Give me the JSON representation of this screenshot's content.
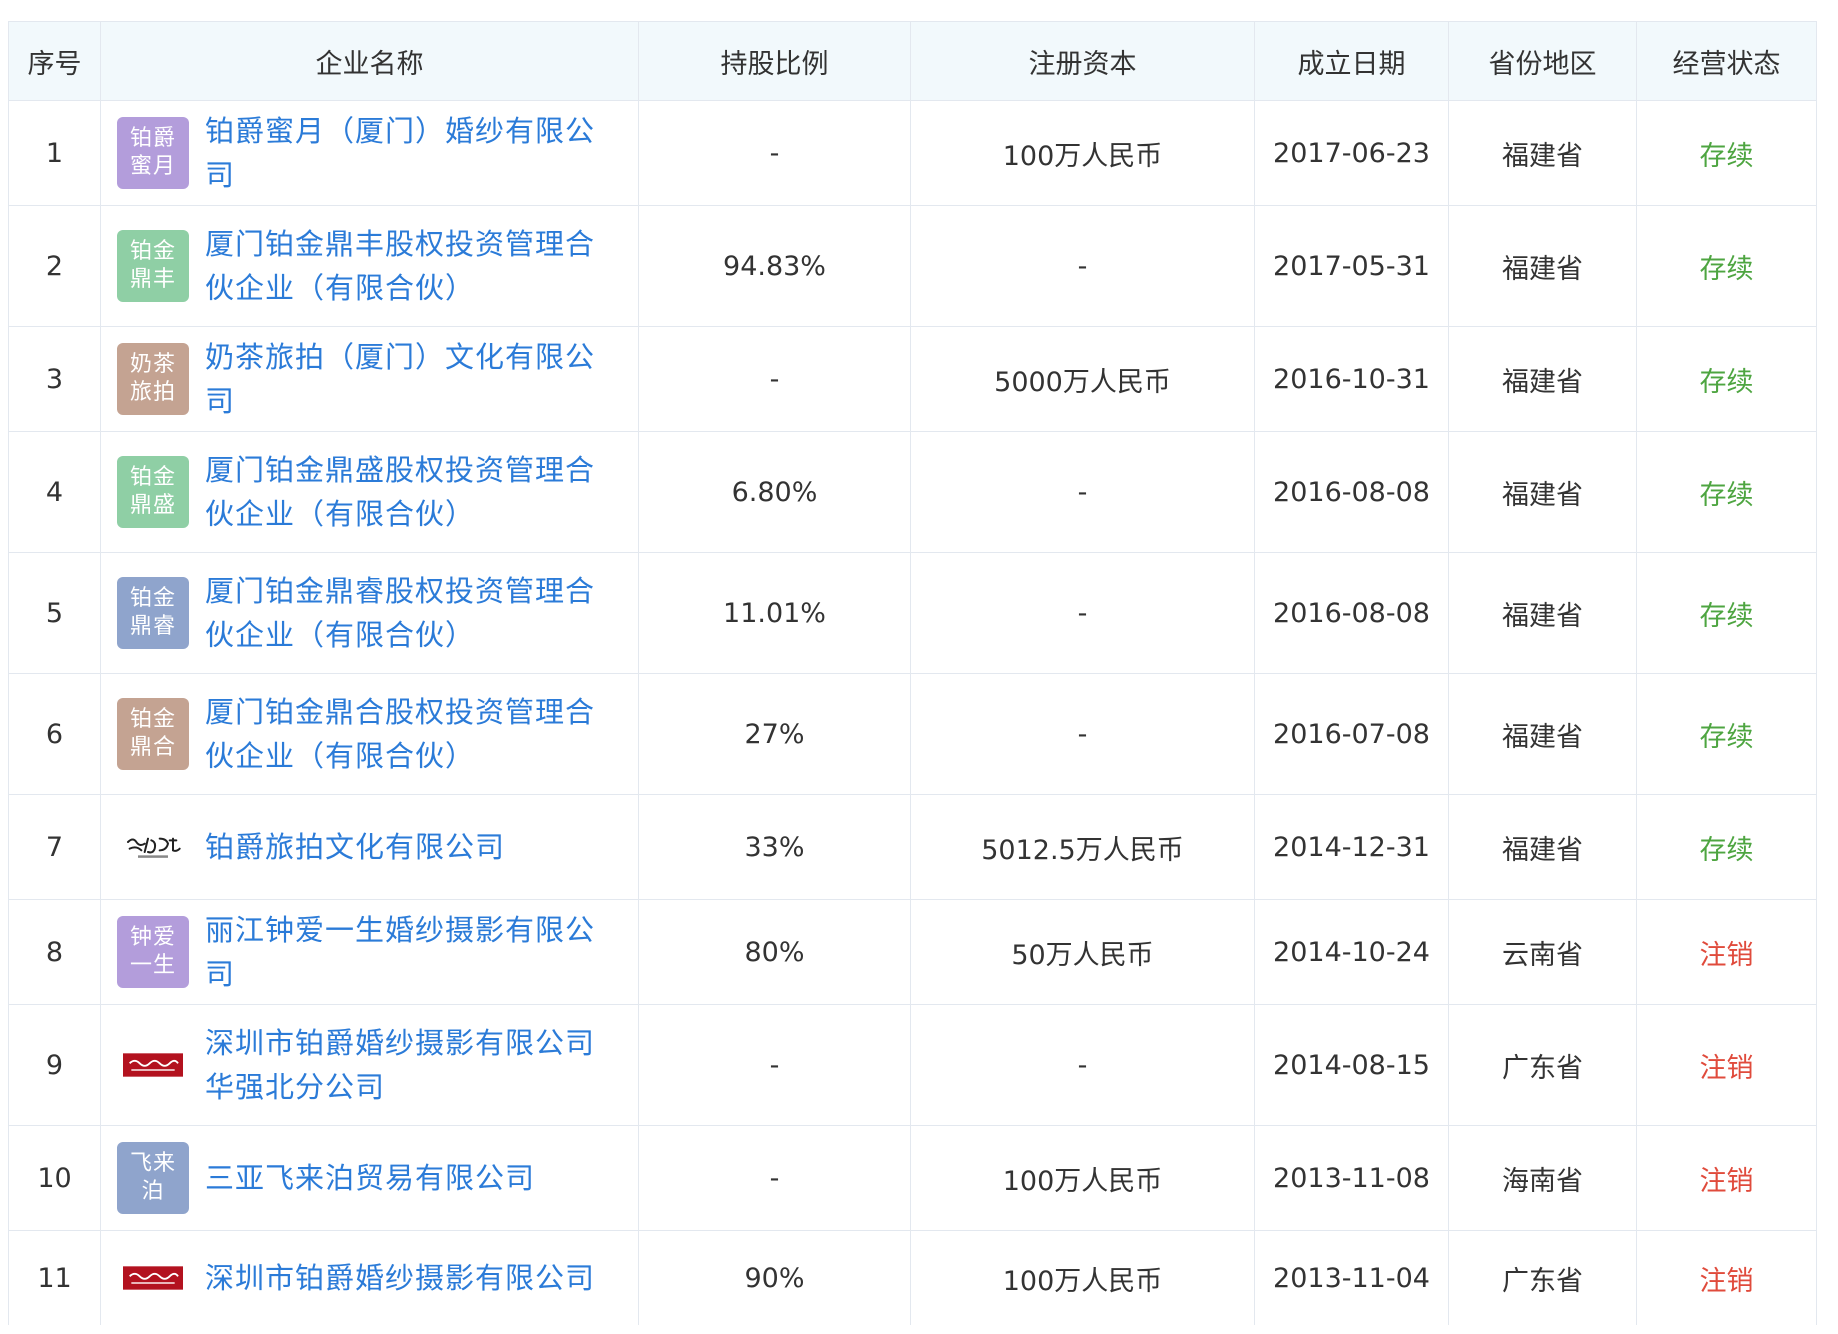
{
  "table": {
    "headers": [
      "序号",
      "企业名称",
      "持股比例",
      "注册资本",
      "成立日期",
      "省份地区",
      "经营状态"
    ],
    "rows": [
      {
        "no": "1",
        "logo_text": "铂爵蜜月",
        "logo_color": "#b39ddb",
        "name": "铂爵蜜月（厦门）婚纱有限公司",
        "share": "-",
        "capital": "100万人民币",
        "date": "2017-06-23",
        "province": "福建省",
        "status": "存续"
      },
      {
        "no": "2",
        "logo_text": "铂金鼎丰",
        "logo_color": "#8fcfa5",
        "name": "厦门铂金鼎丰股权投资管理合伙企业（有限合伙）",
        "share": "94.83%",
        "capital": "-",
        "date": "2017-05-31",
        "province": "福建省",
        "status": "存续"
      },
      {
        "no": "3",
        "logo_text": "奶茶旅拍",
        "logo_color": "#c4a392",
        "name": "奶茶旅拍（厦门）文化有限公司",
        "share": "-",
        "capital": "5000万人民币",
        "date": "2016-10-31",
        "province": "福建省",
        "status": "存续"
      },
      {
        "no": "4",
        "logo_text": "铂金鼎盛",
        "logo_color": "#8fcfa5",
        "name": "厦门铂金鼎盛股权投资管理合伙企业（有限合伙）",
        "share": "6.80%",
        "capital": "-",
        "date": "2016-08-08",
        "province": "福建省",
        "status": "存续"
      },
      {
        "no": "5",
        "logo_text": "铂金鼎睿",
        "logo_color": "#8fa4cc",
        "name": "厦门铂金鼎睿股权投资管理合伙企业（有限合伙）",
        "share": "11.01%",
        "capital": "-",
        "date": "2016-08-08",
        "province": "福建省",
        "status": "存续"
      },
      {
        "no": "6",
        "logo_text": "铂金鼎合",
        "logo_color": "#c4a392",
        "name": "厦门铂金鼎合股权投资管理合伙企业（有限合伙）",
        "share": "27%",
        "capital": "-",
        "date": "2016-07-08",
        "province": "福建省",
        "status": "存续"
      },
      {
        "no": "7",
        "logo_text": "",
        "logo_color": "",
        "name": "铂爵旅拍文化有限公司",
        "share": "33%",
        "capital": "5012.5万人民币",
        "date": "2014-12-31",
        "province": "福建省",
        "status": "存续"
      },
      {
        "no": "8",
        "logo_text": "钟爱一生",
        "logo_color": "#b39ddb",
        "name": "丽江钟爱一生婚纱摄影有限公司",
        "share": "80%",
        "capital": "50万人民币",
        "date": "2014-10-24",
        "province": "云南省",
        "status": "注销"
      },
      {
        "no": "9",
        "logo_text": "",
        "logo_color": "",
        "name": "深圳市铂爵婚纱摄影有限公司华强北分公司",
        "share": "-",
        "capital": "-",
        "date": "2014-08-15",
        "province": "广东省",
        "status": "注销"
      },
      {
        "no": "10",
        "logo_text": "飞来泊",
        "logo_color": "#8fa4cc",
        "name": "三亚飞来泊贸易有限公司",
        "share": "-",
        "capital": "100万人民币",
        "date": "2013-11-08",
        "province": "海南省",
        "status": "注销"
      },
      {
        "no": "11",
        "logo_text": "",
        "logo_color": "",
        "name": "深圳市铂爵婚纱摄影有限公司",
        "share": "90%",
        "capital": "100万人民币",
        "date": "2013-11-04",
        "province": "广东省",
        "status": "注销"
      }
    ]
  },
  "colors": {
    "link": "#2b7bd8",
    "status_active": "#4ea541",
    "status_cancel": "#e04b3c",
    "header_bg": "#f2f9fc",
    "border": "#e3e8ef"
  }
}
